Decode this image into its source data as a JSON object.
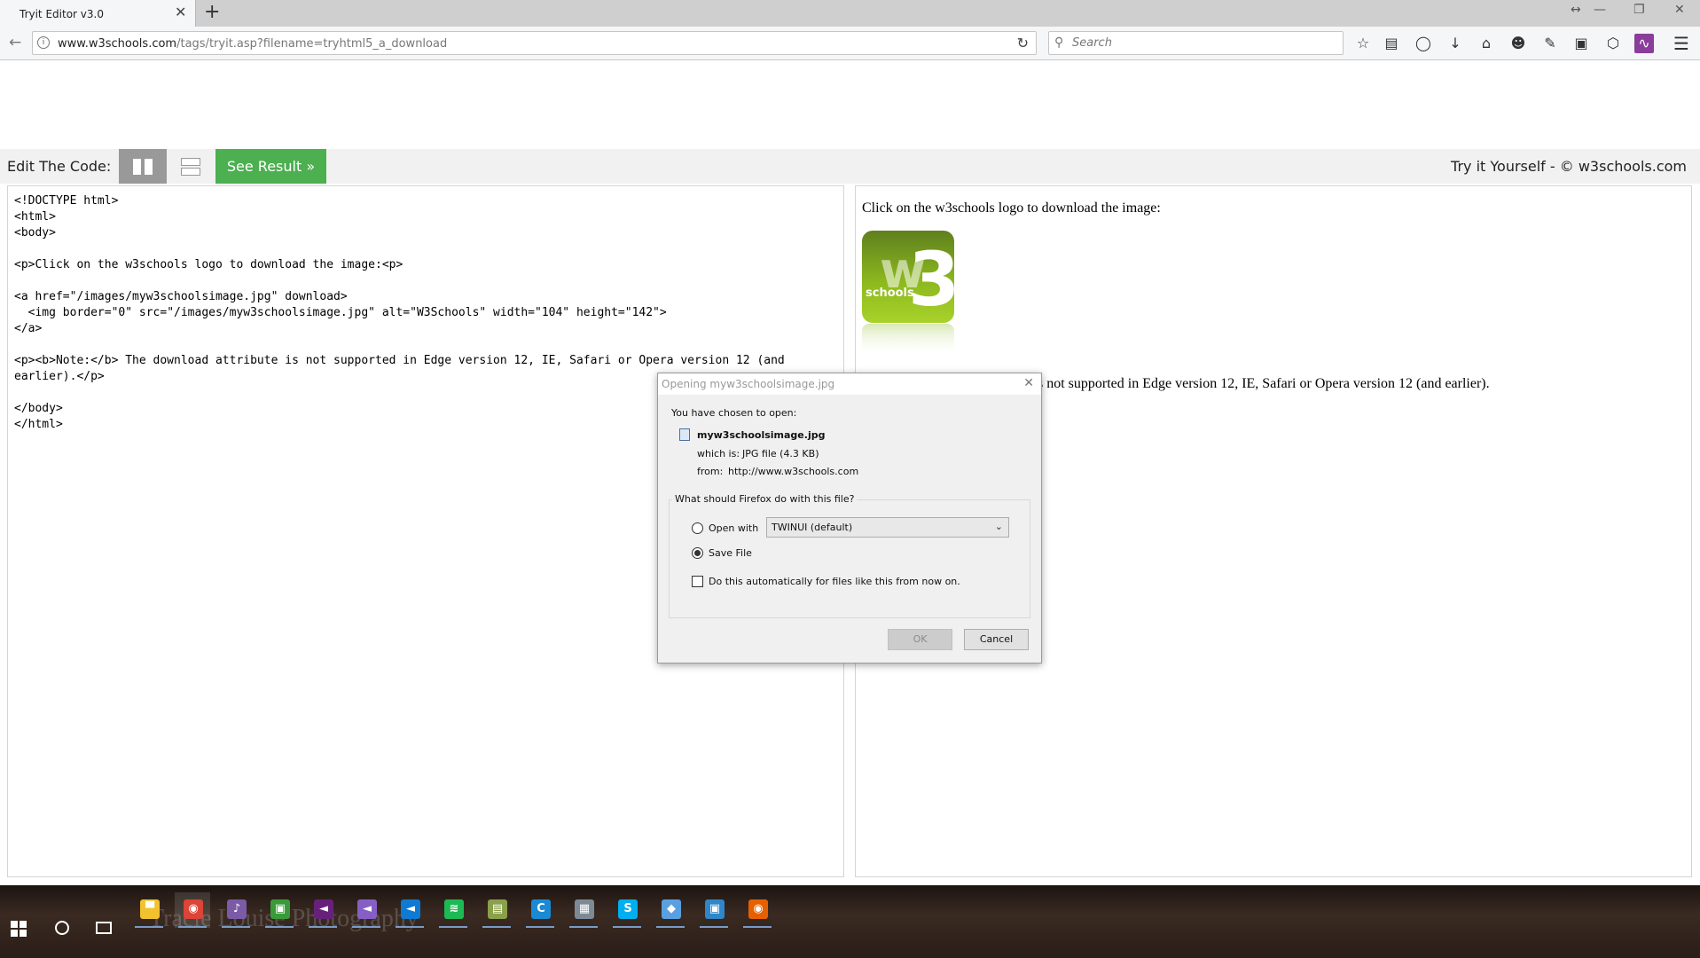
{
  "browser": {
    "tab_title": "Tryit Editor v3.0",
    "tab_close": "✕",
    "new_tab": "+",
    "window_controls": [
      "↔",
      "—",
      "❐",
      "✕"
    ],
    "back_icon": "back-arrow",
    "url_host": "www.w3schools.com",
    "url_path": "/tags/tryit.asp?filename=tryhtml5_a_download",
    "search_placeholder": "Search",
    "toolbar_icons": [
      "star-icon",
      "reading-list-icon",
      "pocket-icon",
      "download-icon",
      "home-icon",
      "smiley-icon",
      "note-icon",
      "shield-icon",
      "extension-icon",
      "rss-icon",
      "menu-icon"
    ]
  },
  "tryit": {
    "edit_label": "Edit The Code:",
    "see_result": "See Result »",
    "right_text": "Try it Yourself - © w3schools.com",
    "code": "<!DOCTYPE html>\n<html>\n<body>\n\n<p>Click on the w3schools logo to download the image:<p>\n\n<a href=\"/images/myw3schoolsimage.jpg\" download>\n  <img border=\"0\" src=\"/images/myw3schoolsimage.jpg\" alt=\"W3Schools\" width=\"104\" height=\"142\">\n</a>\n\n<p><b>Note:</b> The download attribute is not supported in Edge version 12, IE, Safari or Opera version 12 (and earlier).</p>\n\n</body>\n</html>",
    "result_line1": "Click on the w3schools logo to download the image:",
    "result_line2": "s not supported in Edge version 12, IE, Safari or Opera version 12 (and earlier).",
    "logo_text": "schools"
  },
  "dialog": {
    "title": "Opening myw3schoolsimage.jpg",
    "chosen_label": "You have chosen to open:",
    "file_name": "myw3schoolsimage.jpg",
    "which_is_label": "which is:",
    "which_is_value": "JPG file (4.3 KB)",
    "from_label": "from:",
    "from_value": "http://www.w3schools.com",
    "question": "What should Firefox do with this file?",
    "open_with_label": "Open with",
    "open_with_app": "TWINUI (default)",
    "save_file_label": "Save File",
    "selected_option": "save",
    "auto_label": "Do this automatically for files like this from now on.",
    "auto_checked": false,
    "ok_label": "OK",
    "cancel_label": "Cancel"
  },
  "taskbar": {
    "wallpaper_text": "Tracie Louise Photography",
    "apps": [
      {
        "name": "file-explorer-icon",
        "glyph": "▀",
        "color": "#f2c12e"
      },
      {
        "name": "chrome-icon",
        "glyph": "◉",
        "color": "#db4437"
      },
      {
        "name": "app-purple-icon",
        "glyph": "♪",
        "color": "#7b5aa6"
      },
      {
        "name": "app-green-icon",
        "glyph": "▣",
        "color": "#3a9a3a"
      },
      {
        "name": "visual-studio-icon",
        "glyph": "◄",
        "color": "#68217a"
      },
      {
        "name": "visual-studio-alt-icon",
        "glyph": "◄",
        "color": "#865fc5"
      },
      {
        "name": "vscode-icon",
        "glyph": "◄",
        "color": "#0e7ad3"
      },
      {
        "name": "spotify-icon",
        "glyph": "≋",
        "color": "#1db954"
      },
      {
        "name": "app-image-icon",
        "glyph": "▤",
        "color": "#8aa04a"
      },
      {
        "name": "app-cyan-icon",
        "glyph": "C",
        "color": "#1a8ad4"
      },
      {
        "name": "app-gray-icon",
        "glyph": "▦",
        "color": "#7d8a96"
      },
      {
        "name": "skype-icon",
        "glyph": "S",
        "color": "#00aff0"
      },
      {
        "name": "app-blue-icon",
        "glyph": "◆",
        "color": "#5aa0e0"
      },
      {
        "name": "app-lightblue-icon",
        "glyph": "▣",
        "color": "#2f86c8"
      },
      {
        "name": "firefox-icon",
        "glyph": "◉",
        "color": "#e66000"
      }
    ]
  },
  "colors": {
    "accent_green": "#4caf50",
    "logo_green": "#8cb81e"
  }
}
